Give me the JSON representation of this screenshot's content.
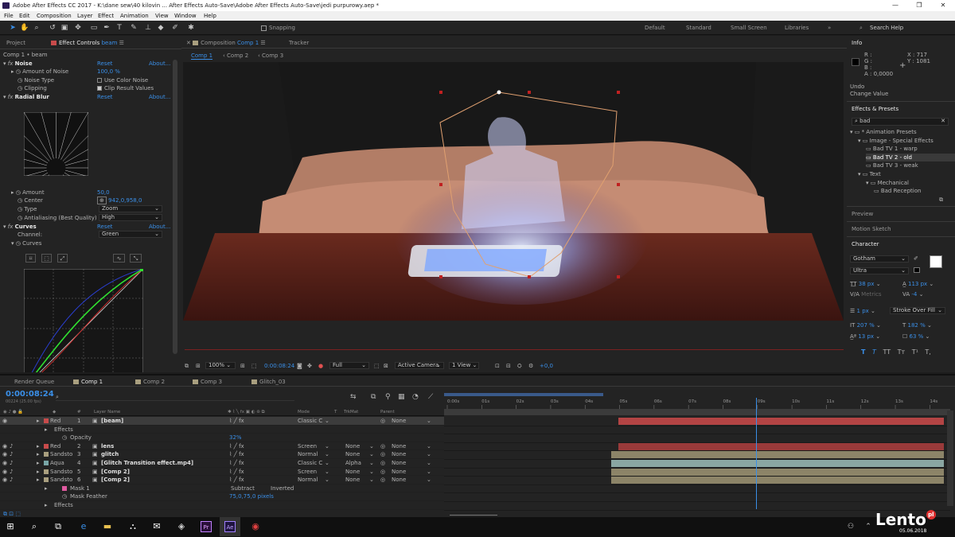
{
  "window": {
    "title": "Adobe After Effects CC 2017 - K:\\dane sew\\40 kilovin ...  After Effects Auto-Save\\Adobe After Effects Auto-Save\\jedi purpurowy.aep *"
  },
  "menu": [
    "File",
    "Edit",
    "Composition",
    "Layer",
    "Effect",
    "Animation",
    "View",
    "Window",
    "Help"
  ],
  "toolbar": {
    "snapping": "Snapping",
    "workspaces": [
      "Default",
      "Standard",
      "Small Screen",
      "Libraries"
    ],
    "search_placeholder": "Search Help"
  },
  "left_panel": {
    "tabs": {
      "project": "Project",
      "effect_controls": "Effect Controls",
      "effect_controls_layer": "beam"
    },
    "breadcrumb": "Comp 1 • beam",
    "effects": [
      {
        "name": "Noise",
        "reset": "Reset",
        "about": "About...",
        "props": [
          {
            "label": "Amount of Noise",
            "value": "100,0 %"
          },
          {
            "label": "Noise Type",
            "value": "Use Color Noise"
          },
          {
            "label": "Clipping",
            "value": "Clip Result Values"
          }
        ]
      },
      {
        "name": "Radial Blur",
        "reset": "Reset",
        "about": "About...",
        "props": [
          {
            "label": "Amount",
            "value": "50,0"
          },
          {
            "label": "Center",
            "value": "942,0,958,0"
          },
          {
            "label": "Type",
            "value": "Zoom"
          },
          {
            "label": "Antialiasing (Best Quality)",
            "value": "High"
          }
        ]
      },
      {
        "name": "Curves",
        "reset": "Reset",
        "about": "About...",
        "props": [
          {
            "label": "Channel:",
            "value": "Green"
          },
          {
            "label": "Curves",
            "value": ""
          }
        ]
      }
    ]
  },
  "composition": {
    "tab_label": "Composition",
    "tab_comp": "Comp 1",
    "tracker": "Tracker",
    "subtabs": [
      "Comp 1",
      "Comp 2",
      "Comp 3"
    ],
    "footer": {
      "zoom": "100%",
      "timecode": "0:00:08:24",
      "resolution": "Full",
      "camera": "Active Camera",
      "view": "1 View",
      "exposure": "+0,0"
    }
  },
  "info_panel": {
    "title": "Info",
    "rgba": [
      "R :",
      "G :",
      "B :",
      "A : 0,0000"
    ],
    "coords": [
      "X : 717",
      "Y : 1081"
    ],
    "undo": "Undo",
    "undo_action": "Change Value"
  },
  "effects_presets": {
    "title": "Effects & Presets",
    "search": "bad",
    "tree": [
      {
        "label": "* Animation Presets",
        "level": 0
      },
      {
        "label": "Image - Special Effects",
        "level": 1
      },
      {
        "label": "Bad TV 1 - warp",
        "level": 2
      },
      {
        "label": "Bad TV 2 - old",
        "level": 2,
        "selected": true
      },
      {
        "label": "Bad TV 3 - weak",
        "level": 2
      },
      {
        "label": "Text",
        "level": 1
      },
      {
        "label": "Mechanical",
        "level": 2
      },
      {
        "label": "Bad Reception",
        "level": 3
      }
    ]
  },
  "side_sections": [
    "Preview",
    "Motion Sketch",
    "Character"
  ],
  "character": {
    "font": "Gotham",
    "style": "Ultra",
    "size": "38 px",
    "leading": "113 px",
    "kerning": "Metrics",
    "tracking": "-4",
    "stroke": "1 px",
    "stroke_mode": "Stroke Over Fill",
    "vscale": "207 %",
    "hscale": "182 %",
    "baseline": "13 px",
    "tsume": "63 %",
    "styles": [
      "T",
      "T",
      "TT",
      "Tт",
      "T¹",
      "T,"
    ]
  },
  "timeline": {
    "tabs": [
      "Render Queue",
      "Comp 1",
      "Comp 2",
      "Comp 3",
      "Glitch_03"
    ],
    "timecode": "0:00:08:24",
    "timecode_sub": "00224 (25.00 fps)",
    "headers": {
      "num": "#",
      "layer": "Layer Name",
      "mode": "Mode",
      "t": "T",
      "trkmat": "TrkMat",
      "parent": "Parent"
    },
    "ruler": [
      "0:00s",
      "01s",
      "02s",
      "03s",
      "04s",
      "05s",
      "06s",
      "07s",
      "08s",
      "09s",
      "10s",
      "11s",
      "12s",
      "13s",
      "14s"
    ],
    "layers": [
      {
        "label": "Red",
        "num": "1",
        "name": "[beam]",
        "mode": "Classic C",
        "trkmat": "",
        "parent": "None",
        "color": "#c84b4b",
        "selected": true
      },
      {
        "label": "",
        "num": "",
        "name": "Effects",
        "mode": "",
        "trkmat": "",
        "parent": "",
        "color": "",
        "sub": true
      },
      {
        "label": "",
        "num": "",
        "name": "Opacity",
        "value": "32%",
        "mode": "",
        "trkmat": "",
        "parent": "",
        "color": "",
        "sub2": true
      },
      {
        "label": "Red",
        "num": "2",
        "name": "lens",
        "mode": "Screen",
        "trkmat": "None",
        "parent": "None",
        "color": "#c84b4b"
      },
      {
        "label": "Sandsto",
        "num": "3",
        "name": "glitch",
        "mode": "Normal",
        "trkmat": "None",
        "parent": "None",
        "color": "#a99f7f"
      },
      {
        "label": "Aqua",
        "num": "4",
        "name": "[Glitch Transition effect.mp4]",
        "mode": "Classic C",
        "trkmat": "Alpha",
        "parent": "None",
        "color": "#79a6a6"
      },
      {
        "label": "Sandsto",
        "num": "5",
        "name": "[Comp 2]",
        "mode": "Screen",
        "trkmat": "None",
        "parent": "None",
        "color": "#a99f7f"
      },
      {
        "label": "Sandsto",
        "num": "6",
        "name": "[Comp 2]",
        "mode": "Normal",
        "trkmat": "None",
        "parent": "None",
        "color": "#a99f7f"
      },
      {
        "label": "",
        "num": "",
        "name": "Mask 1",
        "mode": "Subtract",
        "trkmat": "Inverted",
        "parent": "",
        "color": "#e05aa0",
        "sub": true
      },
      {
        "label": "",
        "num": "",
        "name": "Mask Feather",
        "value": "75,0,75,0 pixels",
        "mode": "",
        "trkmat": "",
        "parent": "",
        "color": "",
        "sub2": true
      },
      {
        "label": "",
        "num": "",
        "name": "Effects",
        "mode": "",
        "trkmat": "",
        "parent": "",
        "color": "",
        "sub": true
      }
    ],
    "playhead_time": 8.96,
    "duration": 14.5
  },
  "taskbar": {
    "brand": "Lento",
    "brand_suffix": "pl",
    "date": "05.06.2018"
  }
}
